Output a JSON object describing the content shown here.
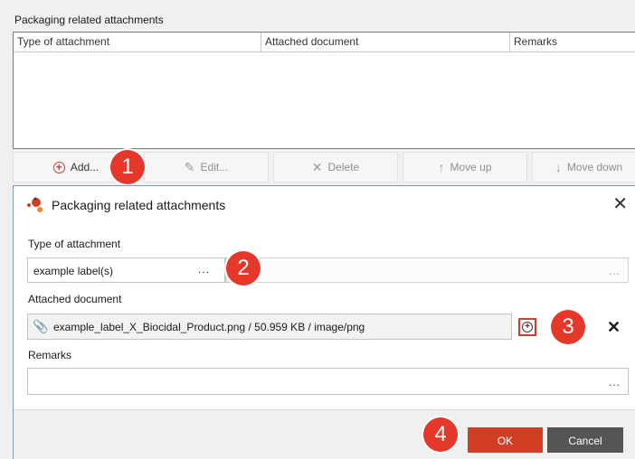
{
  "background_panel": {
    "title": "Packaging related attachments",
    "columns": [
      "Type of attachment",
      "Attached document",
      "Remarks"
    ]
  },
  "background_toolbar": {
    "add_label": "Add...",
    "edit_label": "Edit...",
    "delete_label": "Delete",
    "move_up_label": "Move up",
    "move_down_label": "Move down"
  },
  "annotations": [
    "1",
    "2",
    "3",
    "4"
  ],
  "dialog": {
    "title": "Packaging related attachments",
    "type_label": "Type of attachment",
    "type_value": "example label(s)",
    "type_dots": "...",
    "doc_label": "Attached document",
    "doc_value": "example_label_X_Biocidal_Product.png / 50.959 KB / image/png",
    "remarks_label": "Remarks",
    "remarks_value": "",
    "ellipsis": "...",
    "ok_label": "OK",
    "cancel_label": "Cancel"
  },
  "icons": {
    "add": "plus-circle-icon",
    "edit": "pencil-icon",
    "delete": "x-icon",
    "move_up": "arrow-up-icon",
    "move_down": "arrow-down-icon",
    "attachment": "paperclip-icon",
    "close": "close-icon"
  },
  "colors": {
    "accent_red": "#d03f25",
    "badge_red": "#e5372a",
    "cancel_gray": "#555555",
    "dialog_border": "#7f95b1"
  }
}
